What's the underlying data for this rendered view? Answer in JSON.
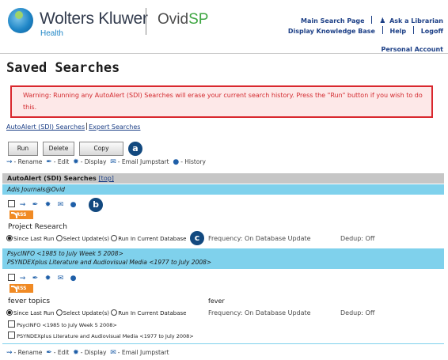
{
  "header": {
    "brand": "Wolters Kluwer",
    "brand_sub": "Health",
    "product_main": "Ovid",
    "product_suffix": "SP",
    "links": {
      "main_search": "Main Search Page",
      "ask_librarian": "Ask a Librarian",
      "knowledge_base": "Display Knowledge Base",
      "help": "Help",
      "logoff": "Logoff",
      "personal_account": "Personal Account"
    }
  },
  "page": {
    "title": "Saved Searches",
    "warning": "Warning: Running any AutoAlert (SDI) Searches will erase your current search history. Press the \"Run\" button if you wish to do this."
  },
  "tabs": {
    "autoalert": "AutoAlert (SDI) Searches",
    "expert": "Expert Searches"
  },
  "toolbar": {
    "run": "Run",
    "delete": "Delete",
    "copy": "Copy"
  },
  "callouts": {
    "a": "a",
    "b": "b",
    "c": "c"
  },
  "legend": {
    "rename": "- Rename",
    "edit": "- Edit",
    "display": "- Display",
    "email_jumpstart": "- Email Jumpstart",
    "history": "- History"
  },
  "section": {
    "title": "AutoAlert (SDI) Searches",
    "top_link": "[top]"
  },
  "searches": [
    {
      "databases": [
        "Adis Journals@Ovid"
      ],
      "rss": "RSS",
      "name": "Project Research",
      "query": "",
      "radio_since": "Since Last Run",
      "radio_select": "Select Update(s)",
      "radio_current": "Run In Current Database",
      "frequency": "Frequency: On Database Update",
      "dedup": "Dedup: Off",
      "db_checks": []
    },
    {
      "databases": [
        "PsycINFO <1985 to July Week 5 2008>",
        "PSYNDEXplus Literature and Audiovisual Media <1977 to July 2008>"
      ],
      "rss": "RSS",
      "name": "fever topics",
      "query": "fever",
      "radio_since": "Since Last Run",
      "radio_select": "Select Update(s)",
      "radio_current": "Run In Current Database",
      "frequency": "Frequency: On Database Update",
      "dedup": "Dedup: Off",
      "db_checks": [
        "PsycINFO <1985 to July Week 5 2008>",
        "PSYNDEXplus Literature and Audiovisual Media <1977 to July 2008>"
      ]
    }
  ],
  "colors": {
    "warning_border": "#d9272e",
    "section_band": "#7fd1ec",
    "link_blue": "#1c3f86",
    "callout": "#12497f"
  }
}
